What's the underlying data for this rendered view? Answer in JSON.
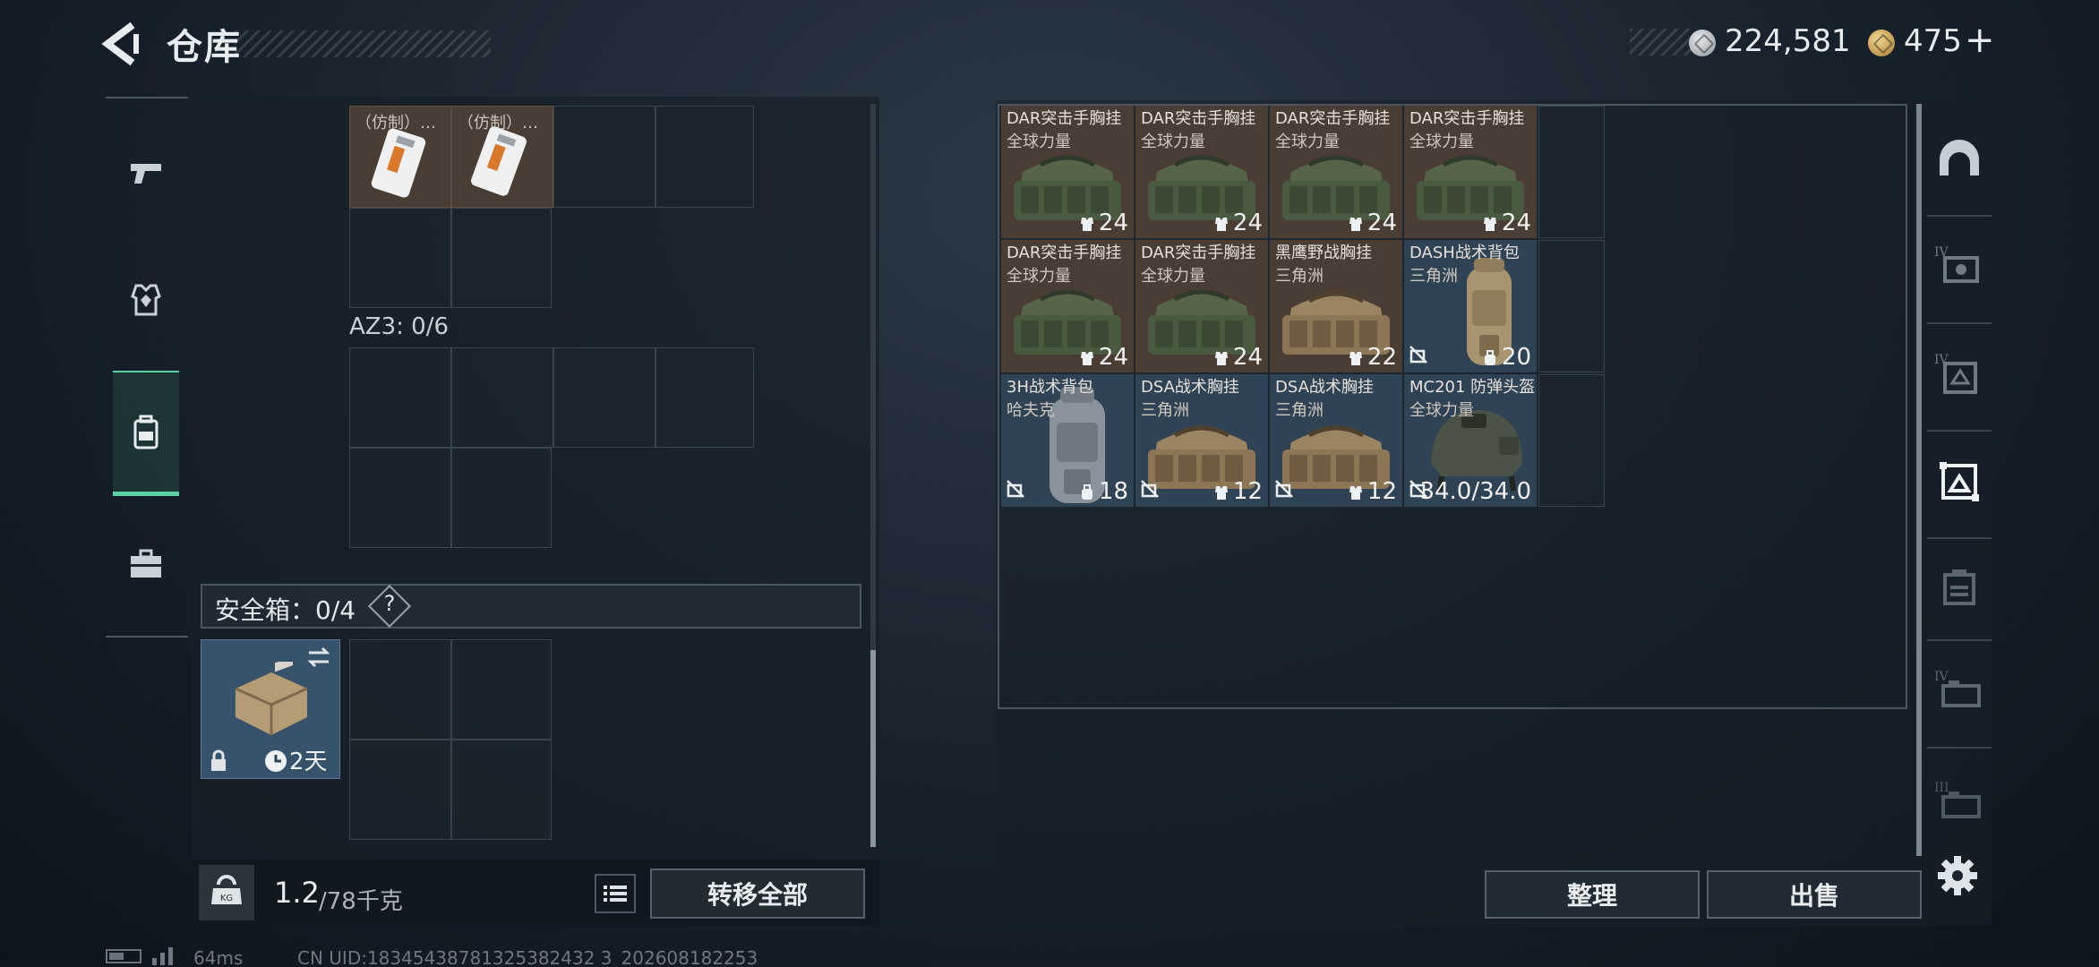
{
  "header": {
    "title": "仓库"
  },
  "currency": {
    "silver": "224,581",
    "gold": "475",
    "plus": "+"
  },
  "left_tabs": [
    {
      "icon": "pistol-icon"
    },
    {
      "icon": "armor-icon"
    },
    {
      "icon": "backpack-icon",
      "active": true
    },
    {
      "icon": "briefcase-icon"
    }
  ],
  "left_panel": {
    "item_label": "（仿制）…",
    "az3_label": "AZ3: 0/6",
    "safe_label": "安全箱：0/4",
    "safe_help": "?",
    "safe_case_time": "2天"
  },
  "weight": {
    "current": "1.2",
    "max": "/78千克"
  },
  "buttons": {
    "transfer_all": "转移全部",
    "sort": "整理",
    "sell": "出售"
  },
  "stash_items": [
    {
      "name": "DAR突击手胸挂",
      "brand": "全球力量",
      "capacity": "24",
      "kind": "bag-green",
      "tone": "brown"
    },
    {
      "name": "DAR突击手胸挂",
      "brand": "全球力量",
      "capacity": "24",
      "kind": "bag-green",
      "tone": "brown"
    },
    {
      "name": "DAR突击手胸挂",
      "brand": "全球力量",
      "capacity": "24",
      "kind": "bag-green",
      "tone": "brown"
    },
    {
      "name": "DAR突击手胸挂",
      "brand": "全球力量",
      "capacity": "24",
      "kind": "bag-green",
      "tone": "brown"
    },
    {
      "name": "DAR突击手胸挂",
      "brand": "全球力量",
      "capacity": "24",
      "kind": "bag-green",
      "tone": "brown"
    },
    {
      "name": "DAR突击手胸挂",
      "brand": "全球力量",
      "capacity": "24",
      "kind": "bag-green",
      "tone": "brown"
    },
    {
      "name": "黑鹰野战胸挂",
      "brand": "三角洲",
      "capacity": "22",
      "kind": "bag-tan",
      "tone": "brown"
    },
    {
      "name": "DASH战术背包",
      "brand": "三角洲",
      "capacity": "20",
      "kind": "backpack-tan",
      "tone": "blue",
      "restricted": true
    },
    {
      "name": "3H战术背包",
      "brand": "哈夫克",
      "capacity": "18",
      "kind": "backpack-grey",
      "tone": "blue",
      "restricted": true
    },
    {
      "name": "DSA战术胸挂",
      "brand": "三角洲",
      "capacity": "12",
      "kind": "bag-tan",
      "tone": "blue",
      "restricted": true
    },
    {
      "name": "DSA战术胸挂",
      "brand": "三角洲",
      "capacity": "12",
      "kind": "bag-tan",
      "tone": "blue",
      "restricted": true
    },
    {
      "name": "MC201 防弹头盔",
      "brand": "全球力量",
      "capacity": "34.0/34.0",
      "kind": "helmet",
      "tone": "blue",
      "restricted": true
    }
  ],
  "right_tabs": [
    "helmet-tab-icon",
    "armor-iv-icon",
    "rig-iv-icon",
    "rig-active-icon",
    "backpack-tab-icon",
    "backpack-iv-icon",
    "backpack-iii-icon"
  ],
  "status": {
    "ping": "64ms",
    "uid": "CN UID:18345438781325382432 3_202608182253"
  },
  "colors": {
    "accent": "#5bcfa6",
    "card_brown": "#4a3d33",
    "card_blue": "#2f4354"
  }
}
